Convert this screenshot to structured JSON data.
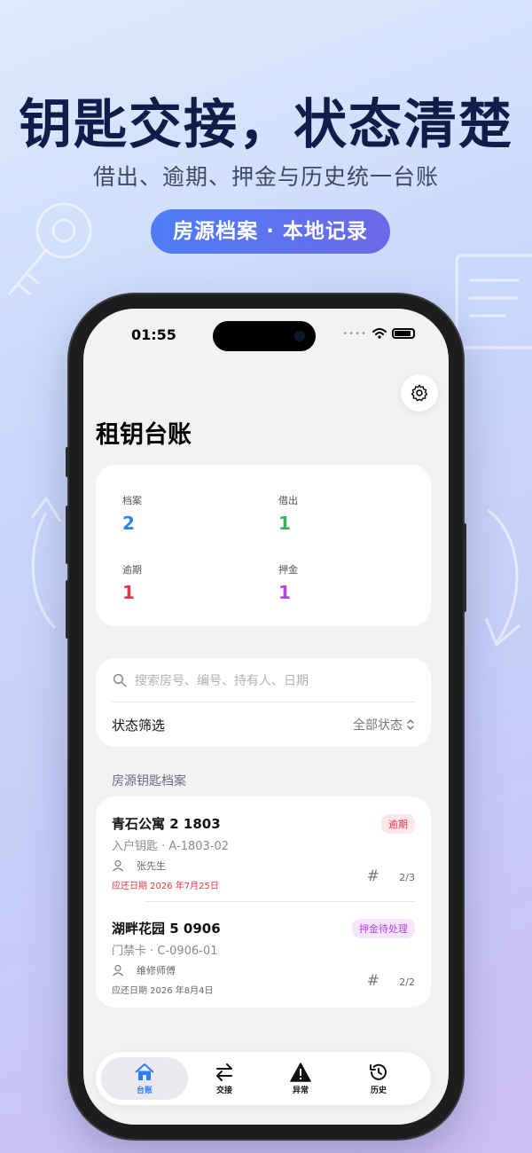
{
  "promo": {
    "headline": "钥匙交接，状态清楚",
    "subline": "借出、逾期、押金与历史统一台账",
    "pill": "房源档案 · 本地记录"
  },
  "status_bar": {
    "time": "01:55"
  },
  "app": {
    "title": "租钥台账",
    "stats": [
      {
        "label": "档案",
        "value": "2",
        "color": "#2f86e8"
      },
      {
        "label": "借出",
        "value": "1",
        "color": "#34b553"
      },
      {
        "label": "逾期",
        "value": "1",
        "color": "#e5364b"
      },
      {
        "label": "押金",
        "value": "1",
        "color": "#b445e0"
      }
    ],
    "search": {
      "placeholder": "搜索房号、编号、持有人、日期"
    },
    "filter": {
      "label": "状态筛选",
      "value": "全部状态"
    },
    "section_label": "房源钥匙档案",
    "records": [
      {
        "name": "青石公寓 2 1803",
        "sub": "入户钥匙 · A-1803-02",
        "holder": "张先生",
        "count": "2/3",
        "due": "应还日期 2026 年7月25日",
        "due_color": "#e5364b",
        "badge": "逾期",
        "badge_color": "#e5364b",
        "badge_bg": "#fde7ea"
      },
      {
        "name": "湖畔花园 5 0906",
        "sub": "门禁卡 · C-0906-01",
        "holder": "维修师傅",
        "count": "2/2",
        "due": "应还日期 2026 年8月4日",
        "due_color": "#666666",
        "badge": "押金待处理",
        "badge_color": "#b445e0",
        "badge_bg": "#f5e6fc"
      }
    ],
    "tabs": [
      {
        "label": "台账",
        "icon": "home-icon",
        "active": true
      },
      {
        "label": "交接",
        "icon": "swap-icon",
        "active": false
      },
      {
        "label": "异常",
        "icon": "warning-icon",
        "active": false
      },
      {
        "label": "历史",
        "icon": "history-icon",
        "active": false
      }
    ],
    "accent_color": "#2f7cf6"
  }
}
